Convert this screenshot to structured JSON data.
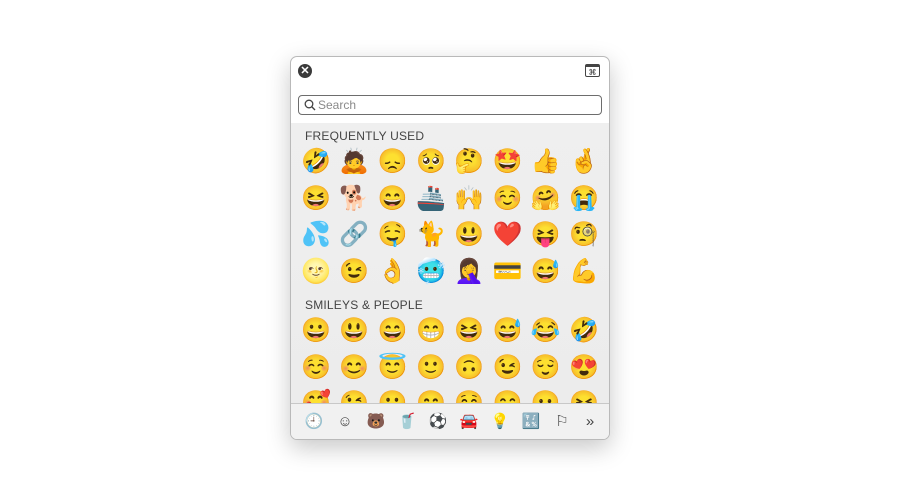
{
  "window": {
    "close_icon": "close-circle-icon",
    "keyboard_viewer_icon": "keyboard-viewer-icon",
    "keyboard_glyph": "⌘"
  },
  "search": {
    "placeholder": "Search",
    "value": ""
  },
  "sections": [
    {
      "title": "FREQUENTLY USED",
      "emojis": [
        "🤣",
        "🙇",
        "😞",
        "🥺",
        "🤔",
        "🤩",
        "👍",
        "🤞",
        "😆",
        "🐕",
        "😄",
        "🚢",
        "🙌",
        "☺️",
        "🤗",
        "😭",
        "💦",
        "🔗",
        "🤤",
        "🐈",
        "😃",
        "❤️",
        "😝",
        "🧐",
        "🌝",
        "😉",
        "👌",
        "🥶",
        "🤦‍♀️",
        "💳",
        "😅",
        "💪"
      ]
    },
    {
      "title": "SMILEYS & PEOPLE",
      "emojis": [
        "😀",
        "😃",
        "😄",
        "😁",
        "😆",
        "😅",
        "😂",
        "🤣",
        "☺️",
        "😊",
        "😇",
        "🙂",
        "🙃",
        "😉",
        "😌",
        "😍",
        "🥰",
        "😘",
        "😗",
        "😙",
        "😚",
        "😋",
        "😛",
        "😝"
      ]
    }
  ],
  "categories": [
    {
      "name": "frequently-used",
      "glyph": "🕘",
      "active": true
    },
    {
      "name": "smileys-people",
      "glyph": "☺"
    },
    {
      "name": "animals-nature",
      "glyph": "🐻"
    },
    {
      "name": "food-drink",
      "glyph": "🥤"
    },
    {
      "name": "activity",
      "glyph": "⚽"
    },
    {
      "name": "travel-places",
      "glyph": "🚘"
    },
    {
      "name": "objects",
      "glyph": "💡"
    },
    {
      "name": "symbols",
      "glyph": "🔣"
    },
    {
      "name": "flags",
      "glyph": "⚐"
    },
    {
      "name": "more",
      "glyph": "»"
    }
  ],
  "colors": {
    "accent": "#2a5bd7",
    "section_text": "#444444"
  }
}
